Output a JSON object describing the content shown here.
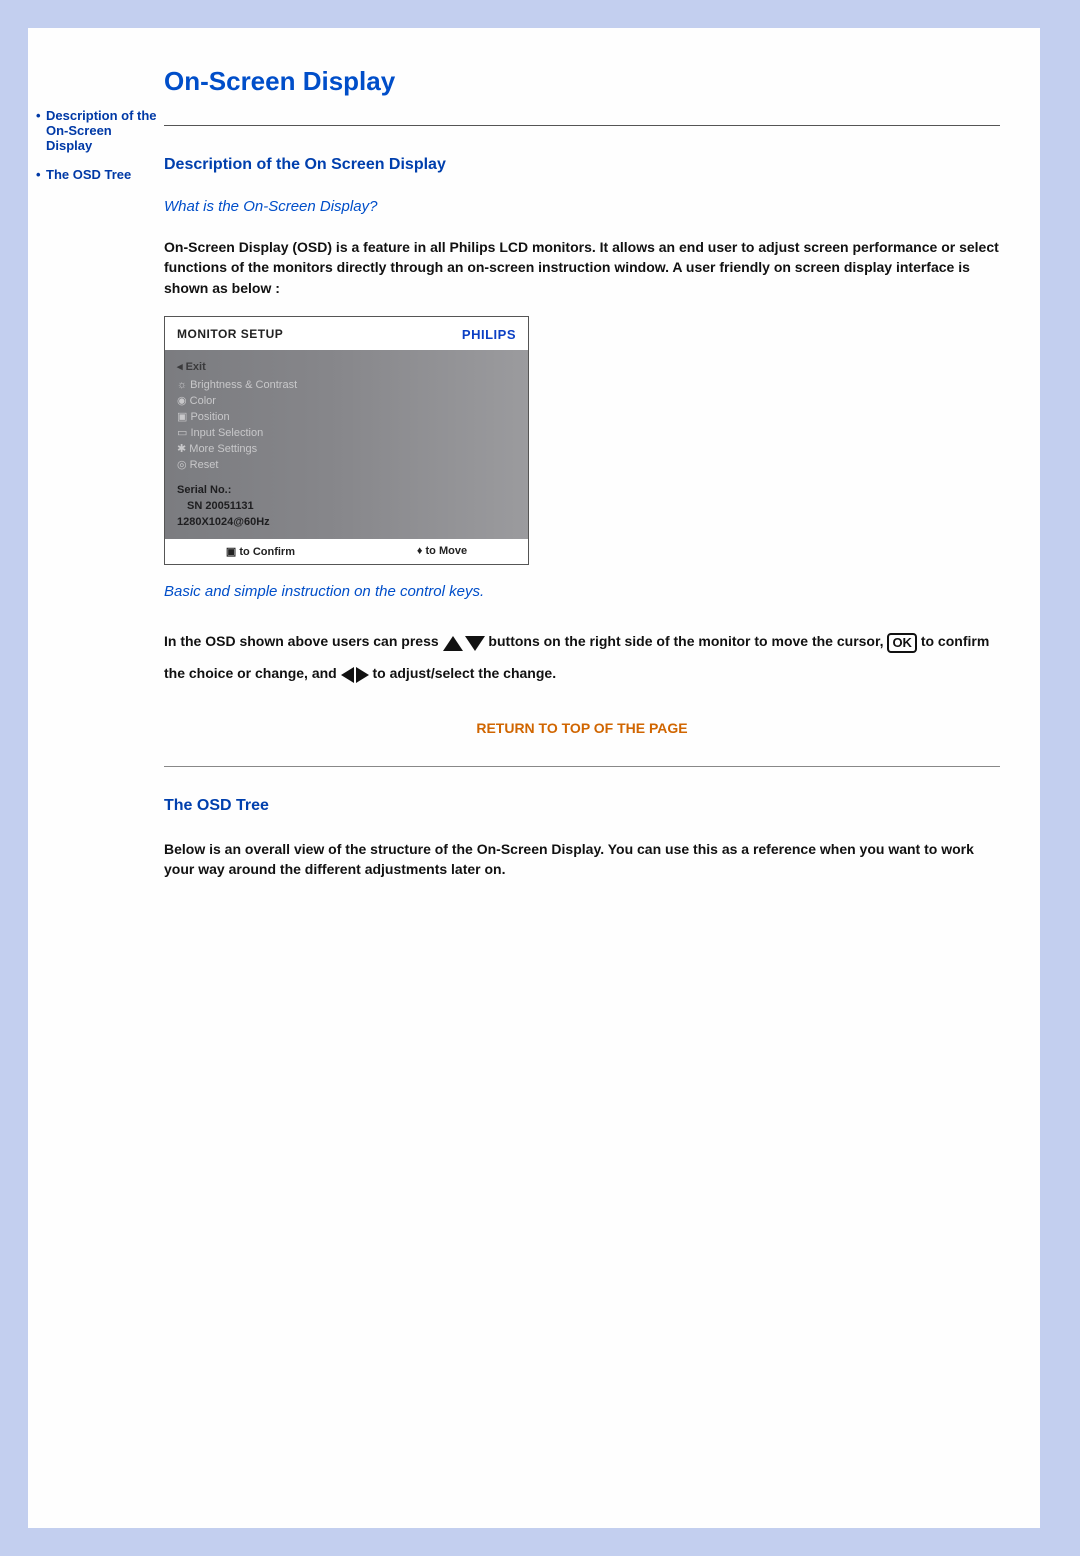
{
  "sidebar": {
    "items": [
      {
        "label": "Description of the On-Screen Display"
      },
      {
        "label": "The OSD Tree"
      }
    ]
  },
  "page_title": "On-Screen Display",
  "section1": {
    "heading": "Description of the On Screen Display",
    "question": "What is the On-Screen Display?",
    "intro": "On-Screen Display (OSD) is a feature in all Philips LCD monitors. It allows an end user to adjust screen performance or select functions of the monitors directly through an on-screen instruction window. A user friendly on screen display interface is shown as below :",
    "caption": "Basic and simple instruction on the control keys.",
    "instructions_1": "In the OSD shown above users can press",
    "instructions_2": "buttons on the right side of the monitor to move the cursor,",
    "instructions_3": "to confirm the choice or change, and",
    "instructions_4": "to adjust/select the change."
  },
  "osd_panel": {
    "title": "MONITOR SETUP",
    "brand": "PHILIPS",
    "menu": [
      "Exit",
      "Brightness & Contrast",
      "Color",
      "Position",
      "Input Selection",
      "More Settings",
      "Reset"
    ],
    "serial_label": "Serial No.:",
    "serial_value": "SN 20051131",
    "resolution": "1280X1024@60Hz",
    "confirm": "to Confirm",
    "move": "to Move",
    "ok_label": "OK"
  },
  "return_link": "RETURN TO TOP OF THE PAGE",
  "section2": {
    "heading": "The OSD Tree",
    "body": "Below is an overall view of the structure of the On-Screen Display. You can use this as a reference when you want to work your way around the different adjustments later on."
  }
}
